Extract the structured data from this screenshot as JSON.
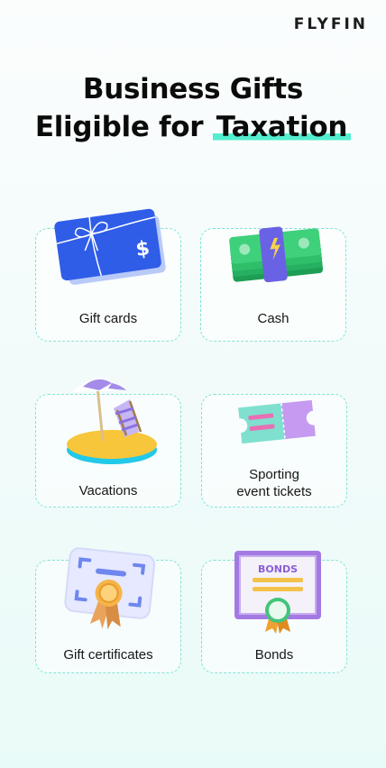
{
  "brand": {
    "logo_text": "FLYFIN"
  },
  "title": {
    "line1": "Business Gifts",
    "line2_prefix": "Eligible for",
    "line2_highlight": "Taxation"
  },
  "cards": [
    {
      "label": "Gift cards",
      "icon": "gift-card-icon"
    },
    {
      "label": "Cash",
      "icon": "cash-stack-icon"
    },
    {
      "label": "Vacations",
      "icon": "beach-chair-icon"
    },
    {
      "label_line1": "Sporting",
      "label_line2": "event tickets",
      "icon": "ticket-icon"
    },
    {
      "label": "Gift certificates",
      "icon": "certificate-icon"
    },
    {
      "label": "Bonds",
      "icon": "bonds-certificate-icon",
      "badge_text": "BONDS"
    }
  ],
  "colors": {
    "accent": "#52eecf",
    "card_border": "#7fe3d4",
    "gift_card_blue": "#2f5de8",
    "cash_green": "#2fbf6a",
    "bond_purple": "#a579e3"
  }
}
